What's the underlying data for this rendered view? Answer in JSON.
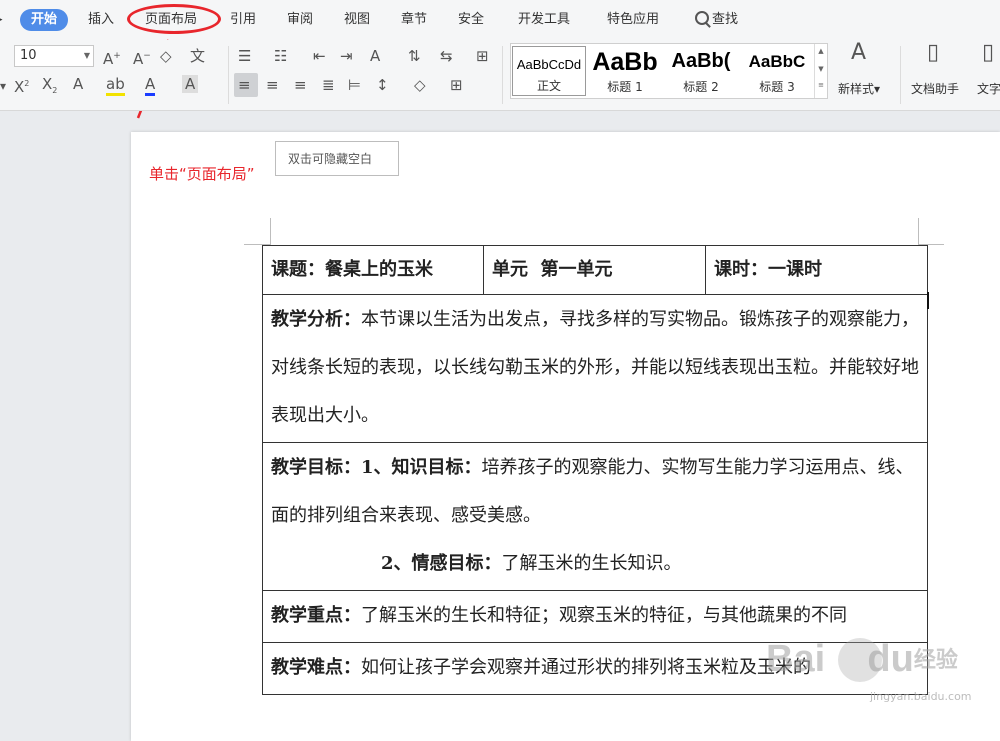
{
  "menu": {
    "tabs": [
      "开始",
      "插入",
      "页面布局",
      "引用",
      "审阅",
      "视图",
      "章节",
      "安全",
      "开发工具",
      "特色应用"
    ],
    "search_label": "查找",
    "active_tab": "开始",
    "highlighted_tab": "页面布局",
    "accent_color": "#4f8ce8",
    "highlight_color": "#e8262c"
  },
  "ribbon": {
    "font_size": "10",
    "styles": [
      {
        "sample": "AaBbCcDd",
        "name": "正文"
      },
      {
        "sample": "AaBb",
        "name": "标题 1"
      },
      {
        "sample": "AaBb(",
        "name": "标题 2"
      },
      {
        "sample": "AaBbC",
        "name": "标题 3"
      }
    ],
    "new_style_label": "新样式",
    "doc_assistant_label": "文档助手",
    "cut_label": "文字"
  },
  "document": {
    "tooltip": "双击可隐藏空白",
    "annotation": "单击“页面布局”",
    "header_row": [
      {
        "label": "课题：",
        "value": "餐桌上的玉米"
      },
      {
        "label": "单元",
        "value": "第一单元"
      },
      {
        "label": "课时：",
        "value": "一课时"
      }
    ],
    "analysis_label": "教学分析：",
    "analysis_text": "本节课以生活为出发点，寻找多样的写实物品。锻炼孩子的观察能力，对线条长短的表现，以长线勾勒玉米的外形，并能以短线表现出玉粒。并能较好地表现出大小。",
    "goal_label": "教学目标：",
    "goal1_label": "1、知识目标：",
    "goal1_text": "培养孩子的观察能力、实物写生能力学习运用点、线、面的排列组合来表现、感受美感。",
    "goal2_label": "2、情感目标：",
    "goal2_text": "了解玉米的生长知识。",
    "key_label": "教学重点：",
    "key_text": "了解玉米的生长和特征；观察玉米的特征，与其他蔬果的不同",
    "diff_label": "教学难点：",
    "diff_text": "如何让孩子学会观察并通过形状的排列将玉米粒及玉米的"
  },
  "watermark": {
    "brand": "Bai",
    "brand2": "du",
    "suffix": "经验",
    "sub": "jingyan.baidu.com"
  }
}
